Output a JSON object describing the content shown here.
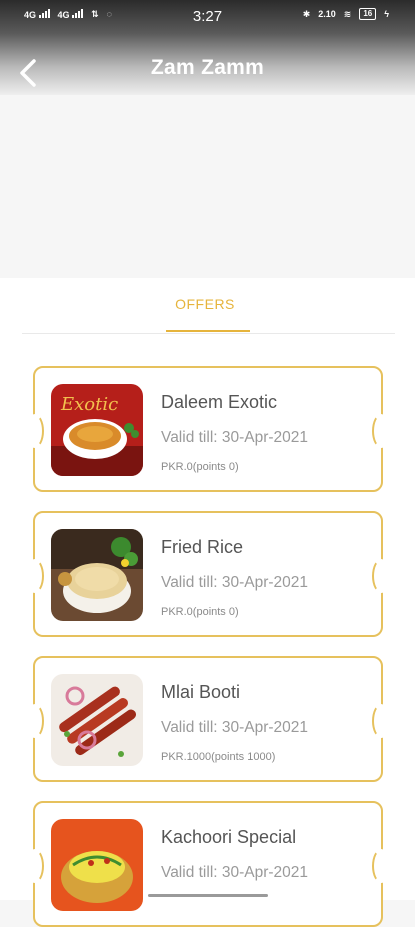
{
  "status_bar": {
    "network_1": "4G",
    "network_2": "4G",
    "time": "3:27",
    "speed": "2.10",
    "battery": "16"
  },
  "header": {
    "title": "Zam Zamm"
  },
  "tabs": [
    {
      "label": "OFFERS",
      "active": true
    }
  ],
  "accent_color": "#e6b43c",
  "offers": [
    {
      "name": "Daleem Exotic",
      "valid": "Valid till: 30-Apr-2021",
      "price": "PKR.0(points 0)",
      "thumb": "daleem-image"
    },
    {
      "name": "Fried Rice",
      "valid": "Valid till: 30-Apr-2021",
      "price": "PKR.0(points 0)",
      "thumb": "fried-rice-image"
    },
    {
      "name": "Mlai Booti",
      "valid": "Valid till: 30-Apr-2021",
      "price": "PKR.1000(points 1000)",
      "thumb": "mlai-booti-image"
    },
    {
      "name": "Kachoori Special",
      "valid": "Valid till: 30-Apr-2021",
      "price": "",
      "thumb": "kachoori-image"
    }
  ]
}
